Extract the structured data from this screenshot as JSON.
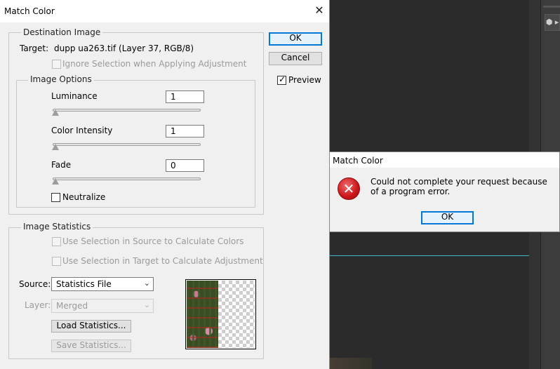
{
  "background": {
    "dock_button_icon": "cube-icon",
    "dock_button_glyph": "⬢ ▸"
  },
  "dialog": {
    "title": "Match Color",
    "close_glyph": "✕",
    "destination": {
      "legend": "Destination Image",
      "target_label": "Target:",
      "target_value": "dupp ua263.tif (Layer 37, RGB/8)",
      "ignore_selection_label": "Ignore Selection when Applying Adjustment",
      "ignore_selection_checked": false
    },
    "image_options": {
      "legend": "Image Options",
      "luminance_label": "Luminance",
      "luminance_value": "1",
      "color_intensity_label": "Color Intensity",
      "color_intensity_value": "1",
      "fade_label": "Fade",
      "fade_value": "0",
      "neutralize_label": "Neutralize",
      "neutralize_checked": false
    },
    "image_statistics": {
      "legend": "Image Statistics",
      "use_source_selection_label": "Use Selection in Source to Calculate Colors",
      "use_target_selection_label": "Use Selection in Target to Calculate Adjustment",
      "source_label": "Source:",
      "source_value": "Statistics File",
      "layer_label": "Layer:",
      "layer_value": "Merged",
      "load_button": "Load Statistics...",
      "save_button": "Save Statistics..."
    },
    "buttons": {
      "ok": "OK",
      "cancel": "Cancel"
    },
    "preview_label": "Preview",
    "preview_checked": true,
    "check_glyph": "✓",
    "chevron_glyph": "⌄"
  },
  "error_dialog": {
    "title": "Match Color",
    "icon": "error-icon",
    "icon_glyph": "✕",
    "message": "Could not complete your request because of a program error.",
    "ok": "OK"
  },
  "colors": {
    "accent": "#0078d7",
    "error": "#c9151b",
    "guide": "#3fb8c8"
  }
}
